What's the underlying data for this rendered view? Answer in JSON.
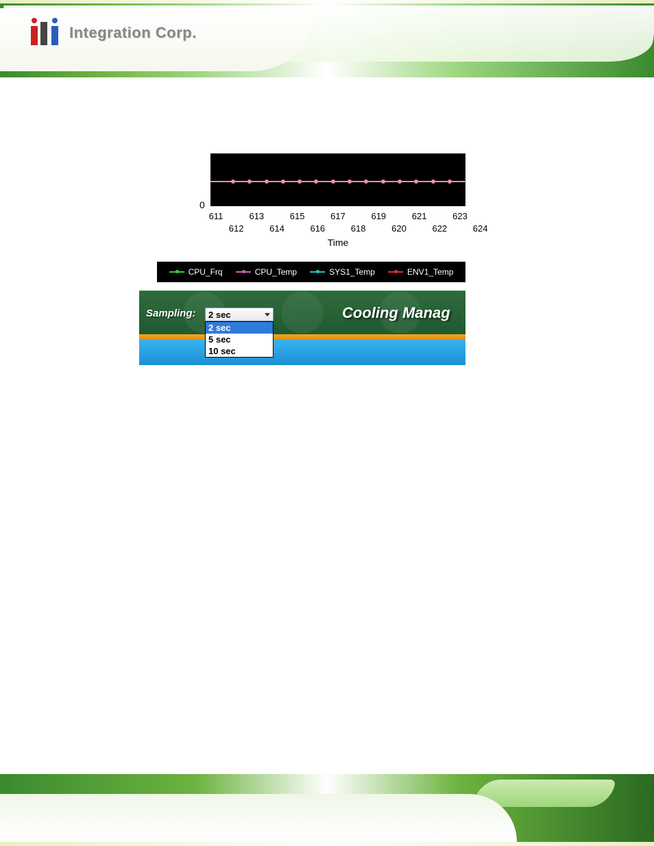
{
  "logo_text": "Integration Corp.",
  "chart_data": {
    "type": "line",
    "title": "",
    "xlabel": "Time",
    "ylabel": "",
    "ylim": [
      0,
      null
    ],
    "x": [
      611,
      612,
      613,
      614,
      615,
      616,
      617,
      618,
      619,
      620,
      621,
      622,
      623,
      624
    ],
    "series": [
      {
        "name": "CPU_Frq",
        "color": "#30d030"
      },
      {
        "name": "CPU_Temp",
        "color": "#d060c0"
      },
      {
        "name": "SYS1_Temp",
        "color": "#20c8c8"
      },
      {
        "name": "ENV1_Temp",
        "color": "#e03030"
      }
    ],
    "y_tick_labels": [
      "0"
    ],
    "x_tick_labels_top": [
      "611",
      "613",
      "615",
      "617",
      "619",
      "621",
      "623"
    ],
    "x_tick_labels_bottom": [
      "612",
      "614",
      "616",
      "618",
      "620",
      "622",
      "624"
    ]
  },
  "sampling": {
    "label": "Sampling:",
    "selected": "2 sec",
    "options": [
      "2 sec",
      "5 sec",
      "10 sec"
    ]
  },
  "cooling_title": "Cooling Manag",
  "colors": {
    "plot_bg": "#000000",
    "legend_bg": "#000000",
    "accent_green": "#2e6b3c",
    "accent_orange": "#f5a623",
    "accent_blue": "#39b3ef",
    "dropdown_highlight": "#2f7bd9"
  }
}
